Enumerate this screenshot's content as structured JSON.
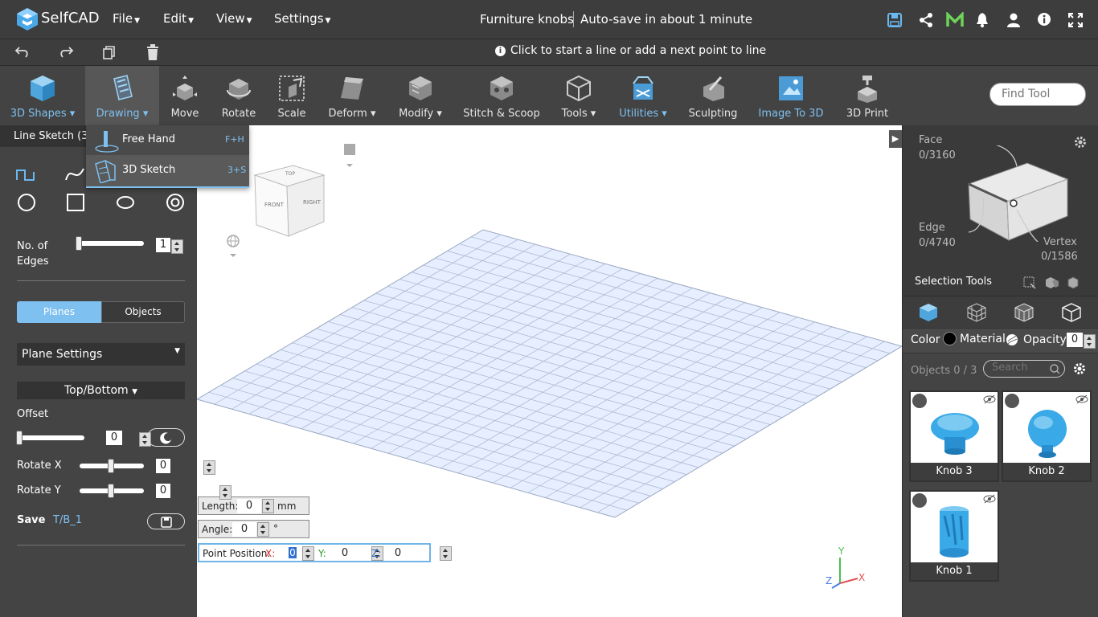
{
  "app": {
    "name": "SelfCAD",
    "file_title": "Furniture knobs",
    "autosave": "Auto-save in about 1 minute"
  },
  "menus": [
    {
      "label": "File"
    },
    {
      "label": "Edit"
    },
    {
      "label": "View"
    },
    {
      "label": "Settings"
    }
  ],
  "hint": "Click to start a line or add a next point to line",
  "toolbar": [
    {
      "label": "3D Shapes",
      "dropdown": true,
      "blue": true
    },
    {
      "label": "Drawing",
      "dropdown": true,
      "blue": true,
      "active": true
    },
    {
      "label": "Move"
    },
    {
      "label": "Rotate"
    },
    {
      "label": "Scale"
    },
    {
      "label": "Deform",
      "dropdown": true
    },
    {
      "label": "Modify",
      "dropdown": true
    },
    {
      "label": "Stitch & Scoop"
    },
    {
      "label": "Tools",
      "dropdown": true
    },
    {
      "label": "Utilities",
      "dropdown": true,
      "blue": true
    },
    {
      "label": "Sculpting"
    },
    {
      "label": "Image To 3D",
      "blue": true
    },
    {
      "label": "3D Print"
    }
  ],
  "find_tool": {
    "placeholder": "Find Tool"
  },
  "drawing_menu": [
    {
      "label": "Free Hand",
      "shortcut": "F+H"
    },
    {
      "label": "3D Sketch",
      "shortcut": "3+S"
    }
  ],
  "panel": {
    "title": "Line Sketch (3+",
    "edges_label": "No. of Edges",
    "edges_value": "1",
    "tabs": [
      "Planes",
      "Objects"
    ],
    "plane_settings": "Plane Settings",
    "plane_mode": "Top/Bottom",
    "offset_label": "Offset",
    "offset_value": "0",
    "rotate_x_label": "Rotate X",
    "rotate_x_value": "0",
    "rotate_y_label": "Rotate Y",
    "rotate_y_value": "0",
    "save_label": "Save",
    "save_name": "T/B_1"
  },
  "viewcube": {
    "front": "FRONT",
    "right": "RIGHT",
    "top": "TOP"
  },
  "inputs": {
    "length_label": "Length:",
    "length_value": "0",
    "length_unit": "mm",
    "angle_label": "Angle:",
    "angle_value": "0",
    "angle_unit": "°",
    "point_label": "Point Position:",
    "x_label": "X:",
    "x_value": "0",
    "y_label": "Y:",
    "y_value": "0",
    "z_label": "Z:",
    "z_value": "0"
  },
  "axes": {
    "x": "X",
    "y": "Y",
    "z": "Z"
  },
  "selection": {
    "face_label": "Face",
    "face_count": "0/3160",
    "edge_label": "Edge",
    "edge_count": "0/4740",
    "vertex_label": "Vertex",
    "vertex_count": "0/1586",
    "tools_label": "Selection Tools"
  },
  "props": {
    "color_label": "Color",
    "material_label": "Material",
    "opacity_label": "Opacity",
    "opacity_value": "0"
  },
  "objects": {
    "count_label": "Objects 0 / 3",
    "search_placeholder": "Search",
    "items": [
      {
        "name": "Knob 3"
      },
      {
        "name": "Knob 2"
      },
      {
        "name": "Knob 1"
      }
    ]
  },
  "colors": {
    "accent": "#7ec0f0",
    "bar": "#3d3d3d",
    "panel": "#444444",
    "object": "#3aa9e8"
  }
}
